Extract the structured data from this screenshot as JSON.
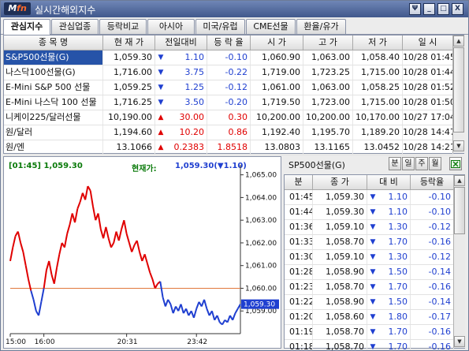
{
  "window": {
    "logo_main": "M",
    "logo_accent": "fn",
    "title": "실시간해외지수",
    "buttons": [
      "Ψ",
      "_",
      "□",
      "X"
    ]
  },
  "tabs": [
    {
      "label": "관심지수",
      "active": true
    },
    {
      "label": "관심업종",
      "active": false
    },
    {
      "label": "등락비교",
      "active": false
    },
    {
      "label": "아시아",
      "active": false
    },
    {
      "label": "미국/유럽",
      "active": false
    },
    {
      "label": "CME선물",
      "active": false
    },
    {
      "label": "환율/유가",
      "active": false
    }
  ],
  "top_table": {
    "headers": [
      "종 목 명",
      "현 재 가",
      "전일대비",
      "등 락 율",
      "시 가",
      "고 가",
      "저 가",
      "일 시"
    ],
    "rows": [
      {
        "name": "S&P500선물(G)",
        "price": "1,059.30",
        "dir": "down",
        "change": "1.10",
        "rate": "-0.10",
        "open": "1,060.90",
        "high": "1,063.00",
        "low": "1,058.40",
        "time": "10/28 01:45",
        "selected": true
      },
      {
        "name": "나스닥100선물(G)",
        "price": "1,716.00",
        "dir": "down",
        "change": "3.75",
        "rate": "-0.22",
        "open": "1,719.00",
        "high": "1,723.25",
        "low": "1,715.00",
        "time": "10/28 01:44",
        "selected": false
      },
      {
        "name": "E-Mini S&P 500 선물",
        "price": "1,059.25",
        "dir": "down",
        "change": "1.25",
        "rate": "-0.12",
        "open": "1,061.00",
        "high": "1,063.00",
        "low": "1,058.25",
        "time": "10/28 01:52",
        "selected": false
      },
      {
        "name": "E-Mini 나스닥 100 선물",
        "price": "1,716.25",
        "dir": "down",
        "change": "3.50",
        "rate": "-0.20",
        "open": "1,719.50",
        "high": "1,723.00",
        "low": "1,715.00",
        "time": "10/28 01:50",
        "selected": false
      },
      {
        "name": "니케이225/달러선물",
        "price": "10,190.00",
        "dir": "up",
        "change": "30.00",
        "rate": "0.30",
        "open": "10,200.00",
        "high": "10,200.00",
        "low": "10,170.00",
        "time": "10/27 17:04",
        "selected": false
      },
      {
        "name": "원/달러",
        "price": "1,194.60",
        "dir": "up",
        "change": "10.20",
        "rate": "0.86",
        "open": "1,192.40",
        "high": "1,195.70",
        "low": "1,189.20",
        "time": "10/28 14:47",
        "selected": false
      },
      {
        "name": "원/엔",
        "price": "13.1066",
        "dir": "up",
        "change": "0.2383",
        "rate": "1.8518",
        "open": "13.0803",
        "high": "13.1165",
        "low": "13.0452",
        "time": "10/28 14:21",
        "selected": false
      }
    ]
  },
  "chart_panel": {
    "time_label": "[01:45] 1,059.30",
    "info_label": "현재가:",
    "info_value": "1,059.30(▼1.10)",
    "current_value_label": "1,059.30"
  },
  "chart_data": {
    "type": "line",
    "title": "",
    "xlabel": "",
    "ylabel": "",
    "x_ticks": [
      "15:00",
      "16:00",
      "20:31",
      "23:42"
    ],
    "y_ticks": [
      "1,065.00",
      "1,064.00",
      "1,063.00",
      "1,062.00",
      "1,061.00",
      "1,060.00",
      "1,059.00"
    ],
    "ylim": [
      1058.0,
      1065.3
    ],
    "reference_line": 1060.0,
    "current_value": 1059.3,
    "colors": {
      "above": "#e00000",
      "below": "#1f3fd0",
      "reference": "#e0783c"
    },
    "series": [
      {
        "values": [
          1061.2,
          1061.8,
          1062.3,
          1062.5,
          1062.0,
          1061.6,
          1061.0,
          1060.4,
          1059.9,
          1059.5,
          1059.0,
          1058.8,
          1059.4,
          1060.0,
          1060.8,
          1061.2,
          1060.6,
          1060.2,
          1060.9,
          1061.5,
          1062.0,
          1061.8,
          1062.4,
          1062.8,
          1063.3,
          1062.9,
          1063.5,
          1063.8,
          1064.2,
          1063.9,
          1064.5,
          1064.3,
          1063.6,
          1063.0,
          1063.3,
          1062.6,
          1062.2,
          1062.7,
          1062.2,
          1061.8,
          1062.0,
          1062.5,
          1062.1,
          1062.6,
          1063.0,
          1062.4,
          1062.0,
          1061.6,
          1061.9,
          1062.1,
          1061.6,
          1061.2,
          1061.5,
          1061.1,
          1060.7,
          1060.4,
          1060.0,
          1060.2,
          1060.3,
          1059.6,
          1059.2,
          1059.5,
          1059.3,
          1058.9,
          1059.2,
          1059.0,
          1059.3,
          1058.9,
          1059.1,
          1058.8,
          1059.0,
          1058.7,
          1059.1,
          1059.4,
          1059.2,
          1059.5,
          1059.1,
          1058.8,
          1059.0,
          1058.6,
          1058.8,
          1058.5,
          1058.4,
          1058.6,
          1058.5,
          1058.8,
          1058.6,
          1058.9,
          1059.1,
          1059.3
        ]
      }
    ]
  },
  "right_panel": {
    "title": "SP500선물(G)",
    "buttons": [
      "분",
      "일",
      "주",
      "월"
    ],
    "headers": [
      "분",
      "종 가",
      "대 비",
      "등락율"
    ],
    "rows": [
      {
        "time": "01:45",
        "close": "1,059.30",
        "change": "1.10",
        "rate": "-0.10"
      },
      {
        "time": "01:44",
        "close": "1,059.30",
        "change": "1.10",
        "rate": "-0.10"
      },
      {
        "time": "01:36",
        "close": "1,059.10",
        "change": "1.30",
        "rate": "-0.12"
      },
      {
        "time": "01:33",
        "close": "1,058.70",
        "change": "1.70",
        "rate": "-0.16"
      },
      {
        "time": "01:30",
        "close": "1,059.10",
        "change": "1.30",
        "rate": "-0.12"
      },
      {
        "time": "01:28",
        "close": "1,058.90",
        "change": "1.50",
        "rate": "-0.14"
      },
      {
        "time": "01:23",
        "close": "1,058.70",
        "change": "1.70",
        "rate": "-0.16"
      },
      {
        "time": "01:22",
        "close": "1,058.90",
        "change": "1.50",
        "rate": "-0.14"
      },
      {
        "time": "01:20",
        "close": "1,058.60",
        "change": "1.80",
        "rate": "-0.17"
      },
      {
        "time": "01:19",
        "close": "1,058.70",
        "change": "1.70",
        "rate": "-0.16"
      },
      {
        "time": "01:18",
        "close": "1,058.70",
        "change": "1.70",
        "rate": "-0.16"
      }
    ]
  }
}
